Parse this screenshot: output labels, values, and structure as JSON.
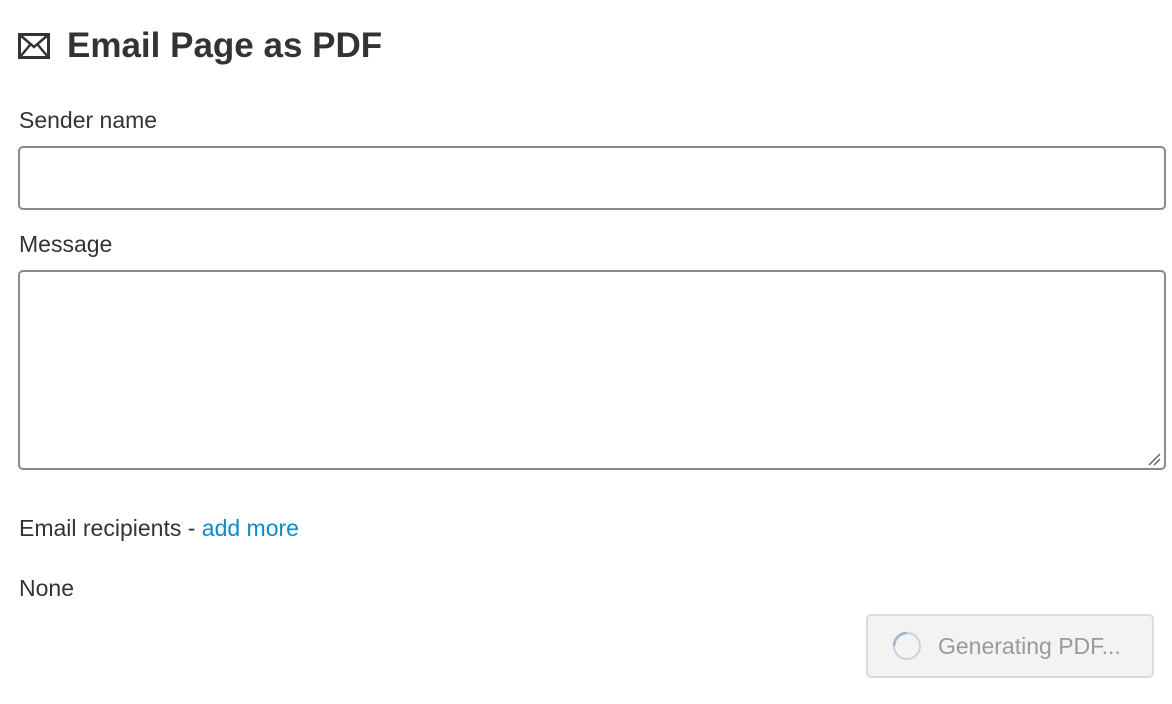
{
  "header": {
    "icon": "envelope-icon",
    "title": "Email Page as PDF"
  },
  "form": {
    "sender_label": "Sender name",
    "sender_value": "",
    "message_label": "Message",
    "message_value": "",
    "recipients_label": "Email recipients - ",
    "add_more_label": "add more",
    "recipients_value": "None"
  },
  "actions": {
    "generate_label": "Generating PDF...",
    "generate_icon": "spinner-icon",
    "generate_state": "disabled"
  },
  "colors": {
    "text": "#333333",
    "link": "#0a8bcc",
    "input_border": "#8a8a8a",
    "disabled_text": "#9a9a9a",
    "disabled_bg": "#f3f3f3"
  }
}
